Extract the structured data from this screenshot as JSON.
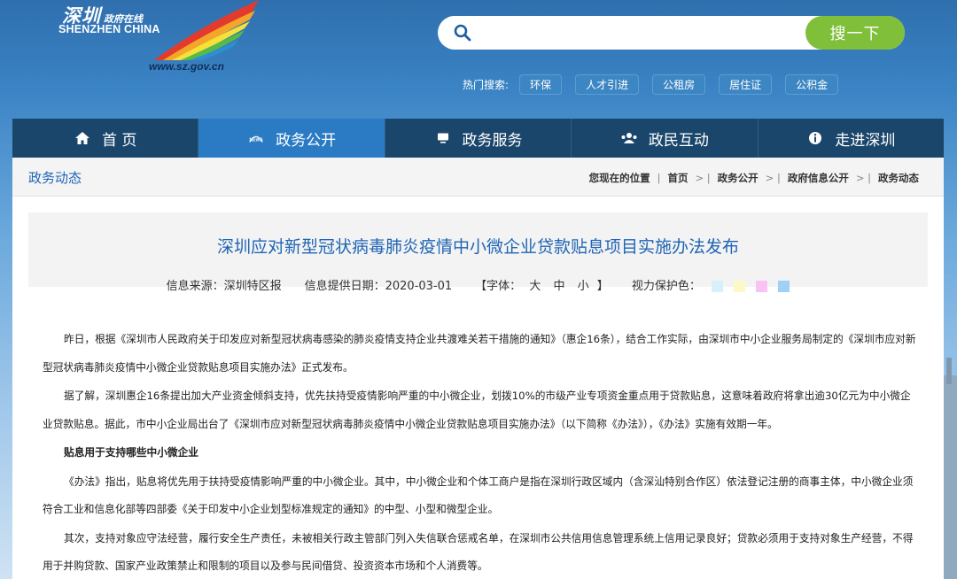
{
  "logo": {
    "cn_title": "深圳",
    "cn_sub": "政府在线",
    "en_title": "SHENZHEN CHINA",
    "url": "www.sz.gov.cn"
  },
  "search": {
    "placeholder": "",
    "button_label": "搜一下"
  },
  "hot_search": {
    "label": "热门搜索:",
    "tags": [
      "环保",
      "人才引进",
      "公租房",
      "居住证",
      "公积金"
    ]
  },
  "nav": [
    {
      "label": "首 页",
      "icon": "home-icon",
      "active": false
    },
    {
      "label": "政务公开",
      "icon": "news-icon",
      "active": true
    },
    {
      "label": "政务服务",
      "icon": "monitor-icon",
      "active": false
    },
    {
      "label": "政民互动",
      "icon": "people-icon",
      "active": false
    },
    {
      "label": "走进深圳",
      "icon": "info-icon",
      "active": false
    }
  ],
  "section_title": "政务动态",
  "breadcrumb": {
    "prefix": "您现在的位置",
    "items": [
      "首页",
      "政务公开",
      "政府信息公开",
      "政务动态"
    ]
  },
  "article": {
    "title": "深圳应对新型冠状病毒肺炎疫情中小微企业贷款贴息项目实施办法发布",
    "source": "信息来源：深圳特区报",
    "date": "信息提供日期：2020-03-01",
    "font_label": "【字体：",
    "font_sizes": [
      "大",
      "中",
      "小"
    ],
    "font_end": "】",
    "eye_care_label": "视力保护色：",
    "eye_care_colors": [
      "#d6f1fb",
      "#fdf8c8",
      "#f8c2f2",
      "#9fd0f5"
    ],
    "paragraphs": [
      {
        "text": "昨日，根据《深圳市人民政府关于印发应对新型冠状病毒感染的肺炎疫情支持企业共渡难关若干措施的通知》（惠企16条），结合工作实际，由深圳市中小企业服务局制定的《深圳市应对新型冠状病毒肺炎疫情中小微企业贷款贴息项目实施办法》正式发布。",
        "bold": false
      },
      {
        "text": "据了解，深圳惠企16条提出加大产业资金倾斜支持，优先扶持受疫情影响严重的中小微企业，划拨10%的市级产业专项资金重点用于贷款贴息，这意味着政府将拿出逾30亿元为中小微企业贷款贴息。据此，市中小企业局出台了《深圳市应对新型冠状病毒肺炎疫情中小微企业贷款贴息项目实施办法》（以下简称《办法》），《办法》实施有效期一年。",
        "bold": false
      },
      {
        "text": "贴息用于支持哪些中小微企业",
        "bold": true
      },
      {
        "text": "《办法》指出，贴息将优先用于扶持受疫情影响严重的中小微企业。其中，中小微企业和个体工商户是指在深圳行政区域内（含深汕特别合作区）依法登记注册的商事主体，中小微企业须符合工业和信息化部等四部委《关于印发中小企业划型标准规定的通知》的中型、小型和微型企业。",
        "bold": false
      },
      {
        "text": "其次，支持对象应守法经营，履行安全生产责任，未被相关行政主管部门列入失信联合惩戒名单，在深圳市公共信用信息管理系统上信用记录良好；贷款必须用于支持对象生产经营，不得用于并购贷款、国家产业政策禁止和限制的项目以及参与民间借贷、投资资本市场和个人消费等。",
        "bold": false
      }
    ]
  }
}
